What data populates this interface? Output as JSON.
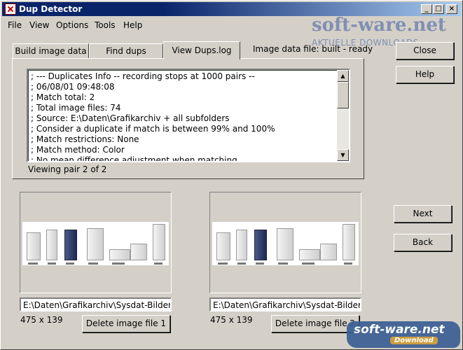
{
  "window": {
    "title": "Dup Detector",
    "controls": {
      "minimize": "_",
      "maximize": "□",
      "close": "×"
    }
  },
  "menu": [
    "File",
    "View",
    "Options",
    "Tools",
    "Help"
  ],
  "watermark_top": {
    "brand": "soft-ware.net",
    "tagline": "AKTUELLE DOWNLOADS"
  },
  "tabs": [
    {
      "label": "Build image data"
    },
    {
      "label": "Find dups"
    },
    {
      "label": "View Dups.log",
      "active": true
    }
  ],
  "status": "Image data file: built - ready",
  "log_lines": [
    "; --- Duplicates Info -- recording stops at 1000 pairs --",
    "; 06/08/01 09:48:08",
    "; Match total: 2",
    "; Total image files: 74",
    "; Source: E:\\Daten\\Grafikarchiv + all subfolders",
    "; Consider a duplicate if match is between 99% and 100%",
    "; Match restrictions: None",
    "; Match method: Color",
    "; No mean difference adjustment when matching"
  ],
  "viewing_text": "Viewing pair 2 of 2",
  "buttons": {
    "close": "Close",
    "help": "Help",
    "next": "Next",
    "back": "Back"
  },
  "left_image": {
    "path": "E:\\Daten\\Grafikarchiv\\Sysdat-Bilder\\co",
    "dims": "475 x 139",
    "delete_label": "Delete image file 1"
  },
  "right_image": {
    "path": "E:\\Daten\\Grafikarchiv\\Sysdat-Bilder\\co",
    "dims": "475 x 139",
    "delete_label": "Delete image file 2"
  },
  "watermark_bottom": {
    "brand": "soft-ware.net",
    "tag": "Download"
  },
  "colors": {
    "face": "#d4d0c8",
    "titlebar": "#0a246a",
    "watermark": "#3b5f93"
  }
}
